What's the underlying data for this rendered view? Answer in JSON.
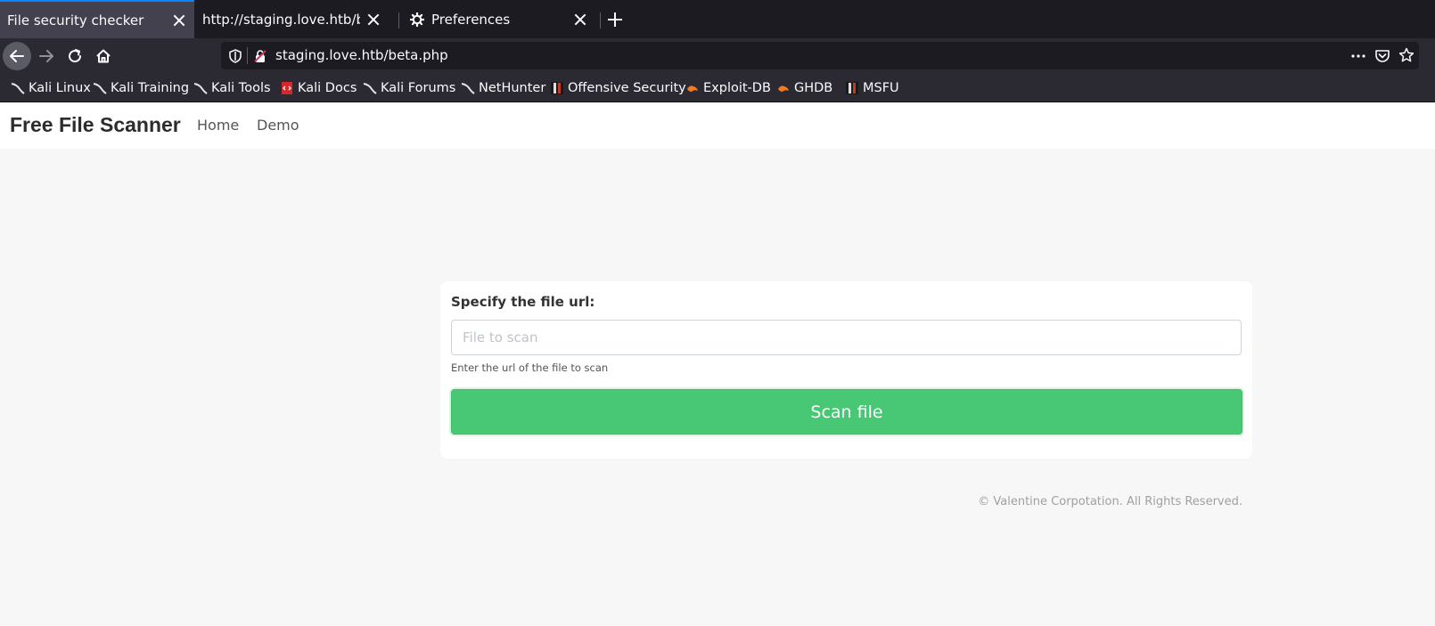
{
  "browser": {
    "tabs": [
      {
        "label": "File security checker",
        "active": true
      },
      {
        "label": "http://staging.love.htb/beta.php",
        "active": false
      },
      {
        "label": "Preferences",
        "active": false
      }
    ],
    "url": "staging.love.htb/beta.php",
    "bookmarks": [
      {
        "label": "Kali Linux",
        "icon": "kali-dragon-icon"
      },
      {
        "label": "Kali Training",
        "icon": "kali-dragon-icon"
      },
      {
        "label": "Kali Tools",
        "icon": "kali-dragon-icon"
      },
      {
        "label": "Kali Docs",
        "icon": "kali-docs-icon"
      },
      {
        "label": "Kali Forums",
        "icon": "kali-dragon-icon"
      },
      {
        "label": "NetHunter",
        "icon": "kali-dragon-icon"
      },
      {
        "label": "Offensive Security",
        "icon": "offsec-icon"
      },
      {
        "label": "Exploit-DB",
        "icon": "exploit-db-icon"
      },
      {
        "label": "GHDB",
        "icon": "exploit-db-icon"
      },
      {
        "label": "MSFU",
        "icon": "offsec-icon"
      }
    ]
  },
  "site": {
    "brand": "Free File Scanner",
    "nav": {
      "home": "Home",
      "demo": "Demo"
    }
  },
  "form": {
    "label": "Specify the file url:",
    "placeholder": "File to scan",
    "value": "",
    "help": "Enter the url of the file to scan",
    "submit": "Scan file"
  },
  "footer": "© Valentine Corpotation. All Rights Reserved.",
  "colors": {
    "accent": "#48c774",
    "tab_accent": "#0a84ff",
    "chrome_dark": "#1c1b22",
    "chrome": "#2b2a33"
  }
}
